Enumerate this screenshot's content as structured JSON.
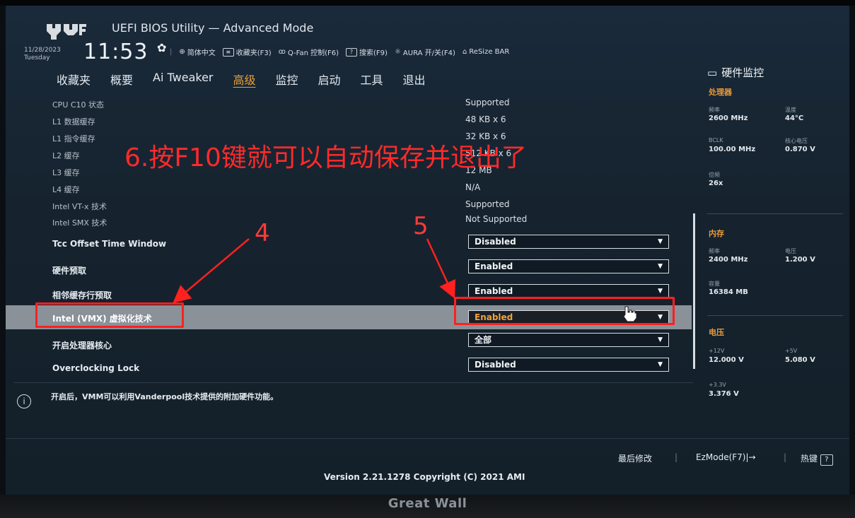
{
  "header": {
    "title": "UEFI BIOS Utility — Advanced Mode",
    "date": "11/28/2023",
    "weekday": "Tuesday",
    "time": "11:53",
    "toolbar": [
      {
        "icon": "globe-icon",
        "label": "简体中文"
      },
      {
        "icon": "bookmark-icon",
        "label": "收藏夹(F3)"
      },
      {
        "icon": "fan-icon",
        "label": "Q-Fan 控制(F6)"
      },
      {
        "icon": "help-icon",
        "label": "搜索(F9)"
      },
      {
        "icon": "aura-icon",
        "label": "AURA 开/关(F4)"
      },
      {
        "icon": "resize-bar-icon",
        "label": "ReSize BAR"
      }
    ]
  },
  "menu": [
    "收藏夹",
    "概要",
    "Ai Tweaker",
    "高级",
    "监控",
    "启动",
    "工具",
    "退出"
  ],
  "info_rows": [
    {
      "label": "CPU C10 状态",
      "value": "Supported"
    },
    {
      "label": "L1 数据缓存",
      "value": "48 KB x 6"
    },
    {
      "label": "L1 指令缓存",
      "value": "32 KB x 6"
    },
    {
      "label": "L2 缓存",
      "value": "512 KB x 6"
    },
    {
      "label": "L3 缓存",
      "value": "12 MB"
    },
    {
      "label": "L4 缓存",
      "value": "N/A"
    },
    {
      "label": "Intel VT-x 技术",
      "value": "Supported"
    },
    {
      "label": "Intel SMX 技术",
      "value": "Not Supported"
    }
  ],
  "setting_rows": [
    {
      "label": "Tcc Offset Time Window",
      "value": "Disabled"
    },
    {
      "label": "硬件预取",
      "value": "Enabled"
    },
    {
      "label": "相邻缓存行预取",
      "value": "Enabled"
    },
    {
      "label": "Intel (VMX) 虚拟化技术",
      "value": "Enabled"
    },
    {
      "label": "开启处理器核心",
      "value": "全部"
    },
    {
      "label": "Overclocking Lock",
      "value": "Disabled"
    }
  ],
  "help_text": "开启后，VMM可以利用Vanderpool技术提供的附加硬件功能。",
  "hardware_monitor": {
    "title": "硬件监控",
    "cpu": {
      "section": "处理器",
      "freq_label": "频率",
      "freq": "2600 MHz",
      "temp_label": "温度",
      "temp": "44°C",
      "bclk_label": "BCLK",
      "bclk": "100.00 MHz",
      "vcore_label": "核心电压",
      "vcore": "0.870 V",
      "ratio_label": "倍频",
      "ratio": "26x"
    },
    "memory": {
      "section": "内存",
      "freq_label": "频率",
      "freq": "2400 MHz",
      "volt_label": "电压",
      "volt": "1.200 V",
      "cap_label": "容量",
      "cap": "16384 MB"
    },
    "voltage": {
      "section": "电压",
      "v12_label": "+12V",
      "v12": "12.000 V",
      "v5_label": "+5V",
      "v5": "5.080 V",
      "v33_label": "+3.3V",
      "v33": "3.376 V"
    }
  },
  "footer": {
    "last_modified": "最后修改",
    "ezmode": "EzMode(F7)|",
    "hotkeys": "热键",
    "version": "Version 2.21.1278 Copyright (C) 2021 AMI"
  },
  "annotation": {
    "instruction": "6.按F10键就可以自动保存并退出了",
    "step4": "4",
    "step5": "5",
    "color": "#ff2020"
  },
  "monitor_brand": "Great Wall"
}
